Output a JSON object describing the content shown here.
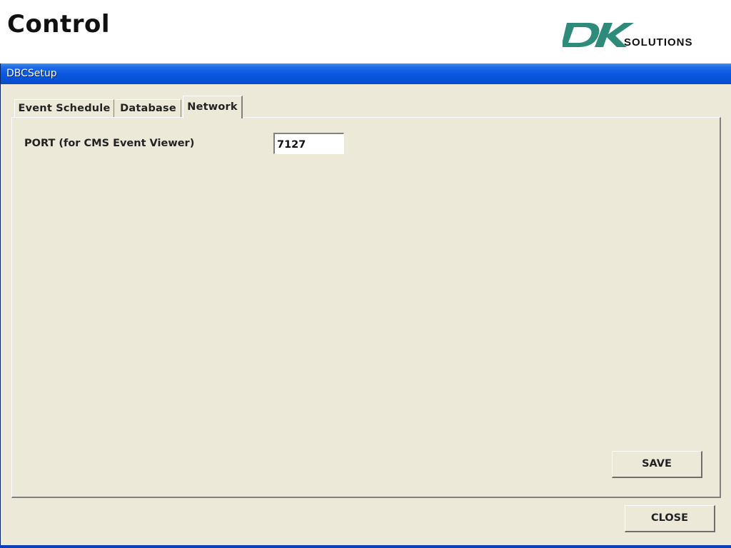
{
  "slide": {
    "title": "Control",
    "logo": {
      "letters": "DK",
      "text": "SOLUTIONS",
      "color": "#2e8b7a"
    }
  },
  "window": {
    "title": "DBCSetup",
    "titlebar_color": "#0a58de",
    "background": "#ece9d8"
  },
  "tabs": [
    {
      "label": "Event Schedule",
      "active": false
    },
    {
      "label": "Database",
      "active": false
    },
    {
      "label": "Network",
      "active": true
    }
  ],
  "network": {
    "port_label": "PORT (for CMS Event Viewer)",
    "port_value": "7127"
  },
  "buttons": {
    "save": "SAVE",
    "close": "CLOSE"
  }
}
